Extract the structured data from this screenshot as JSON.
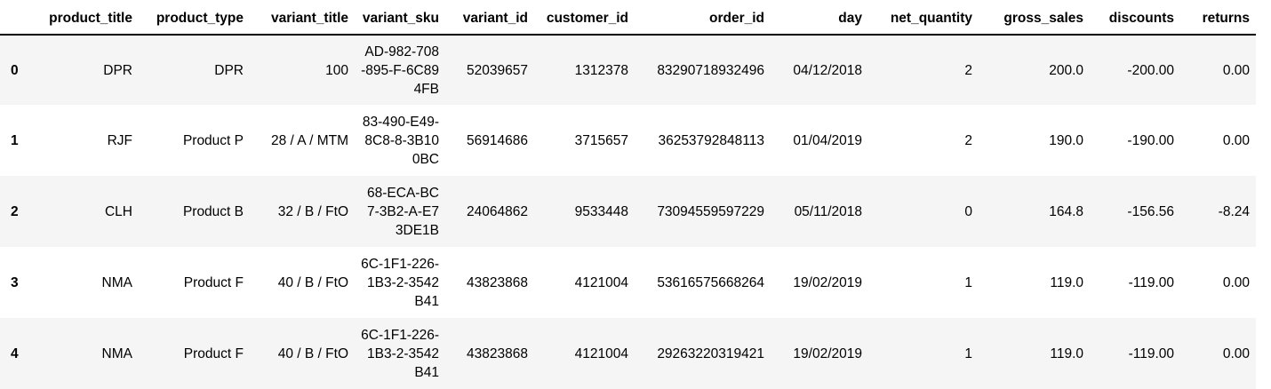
{
  "table": {
    "columns": [
      "",
      "product_title",
      "product_type",
      "variant_title",
      "variant_sku",
      "variant_id",
      "customer_id",
      "order_id",
      "day",
      "net_quantity",
      "gross_sales",
      "discounts",
      "returns"
    ],
    "rows": [
      {
        "index": "0",
        "product_title": "DPR",
        "product_type": "DPR",
        "variant_title": "100",
        "variant_sku": "AD-982-708-895-F-6C894FB",
        "variant_id": "52039657",
        "customer_id": "1312378",
        "order_id": "83290718932496",
        "day": "04/12/2018",
        "net_quantity": "2",
        "gross_sales": "200.0",
        "discounts": "-200.00",
        "returns": "0.00"
      },
      {
        "index": "1",
        "product_title": "RJF",
        "product_type": "Product P",
        "variant_title": "28 / A / MTM",
        "variant_sku": "83-490-E49-8C8-8-3B100BC",
        "variant_id": "56914686",
        "customer_id": "3715657",
        "order_id": "36253792848113",
        "day": "01/04/2019",
        "net_quantity": "2",
        "gross_sales": "190.0",
        "discounts": "-190.00",
        "returns": "0.00"
      },
      {
        "index": "2",
        "product_title": "CLH",
        "product_type": "Product B",
        "variant_title": "32 / B / FtO",
        "variant_sku": "68-ECA-BC7-3B2-A-E73DE1B",
        "variant_id": "24064862",
        "customer_id": "9533448",
        "order_id": "73094559597229",
        "day": "05/11/2018",
        "net_quantity": "0",
        "gross_sales": "164.8",
        "discounts": "-156.56",
        "returns": "-8.24"
      },
      {
        "index": "3",
        "product_title": "NMA",
        "product_type": "Product F",
        "variant_title": "40 / B / FtO",
        "variant_sku": "6C-1F1-226-1B3-2-3542B41",
        "variant_id": "43823868",
        "customer_id": "4121004",
        "order_id": "53616575668264",
        "day": "19/02/2019",
        "net_quantity": "1",
        "gross_sales": "119.0",
        "discounts": "-119.00",
        "returns": "0.00"
      },
      {
        "index": "4",
        "product_title": "NMA",
        "product_type": "Product F",
        "variant_title": "40 / B / FtO",
        "variant_sku": "6C-1F1-226-1B3-2-3542B41",
        "variant_id": "43823868",
        "customer_id": "4121004",
        "order_id": "29263220319421",
        "day": "19/02/2019",
        "net_quantity": "1",
        "gross_sales": "119.0",
        "discounts": "-119.00",
        "returns": "0.00"
      }
    ]
  }
}
